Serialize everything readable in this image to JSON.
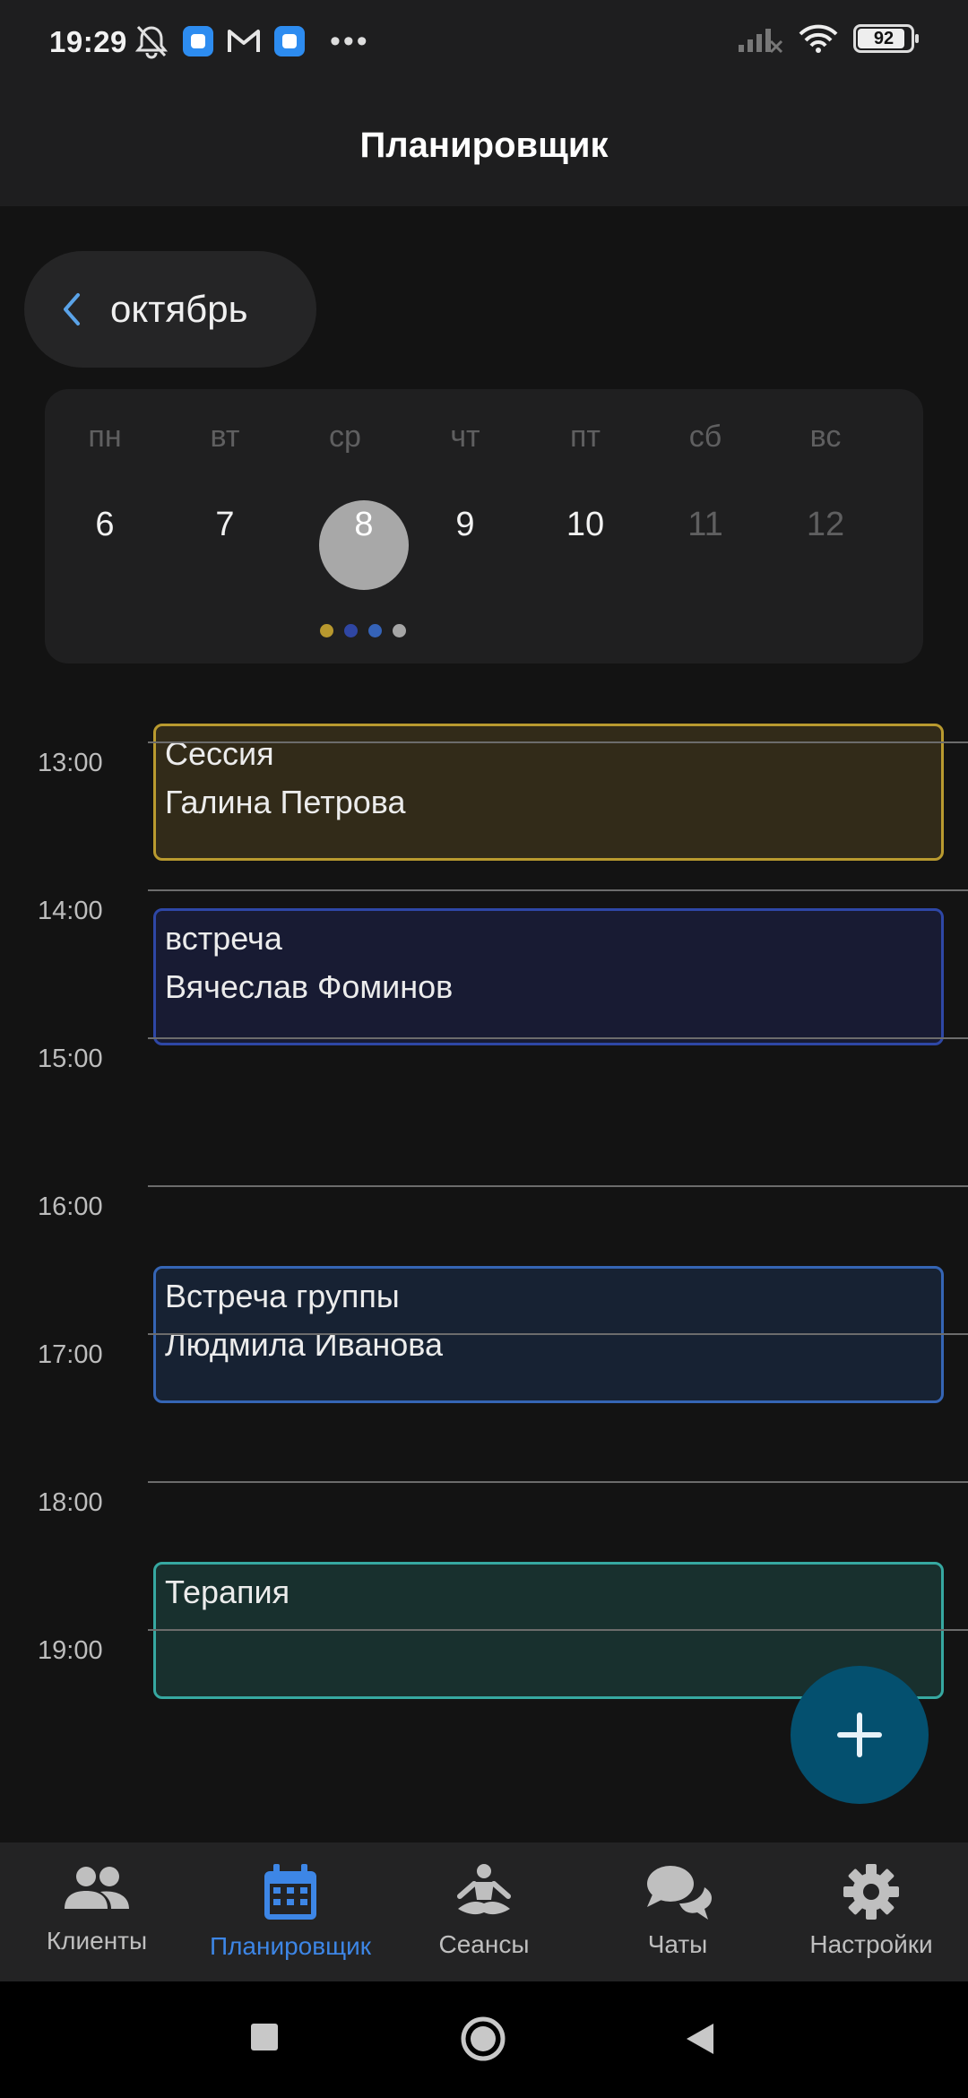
{
  "status_bar": {
    "time": "19:29",
    "battery": "92",
    "icons": [
      "mute-icon",
      "app-icon",
      "gmail-icon",
      "app-icon",
      "more-icon",
      "signal-icon",
      "wifi-icon",
      "battery-icon"
    ]
  },
  "header": {
    "title": "Планировщик"
  },
  "calendar": {
    "month": "октябрь",
    "weekdays": [
      "пн",
      "вт",
      "ср",
      "чт",
      "пт",
      "сб",
      "вс"
    ],
    "days": [
      "6",
      "7",
      "8",
      "9",
      "10",
      "11",
      "12"
    ],
    "selected_day": "8",
    "event_dot_colors": [
      "#b8982e",
      "#2f46a3",
      "#3563b8",
      "#a6a6a6"
    ]
  },
  "timeline": {
    "hours": [
      "13:00",
      "14:00",
      "15:00",
      "16:00",
      "17:00",
      "18:00",
      "19:00"
    ],
    "events": [
      {
        "title": "Сессия",
        "person": "Галина Петрова",
        "border": "#b99a2f",
        "fill": "#322b19"
      },
      {
        "title": "встреча",
        "person": "Вячеслав Фоминов",
        "border": "#2e47a6",
        "fill": "#181b33"
      },
      {
        "title": "Встреча группы",
        "person": "Людмила Иванова",
        "border": "#3565b5",
        "fill": "#172233"
      },
      {
        "title": "Терапия",
        "person": "",
        "border": "#36a8a1",
        "fill": "#18302e"
      }
    ]
  },
  "fab": {
    "icon": "plus-icon",
    "color": "#04506f"
  },
  "bottom_nav": {
    "items": [
      {
        "label": "Клиенты",
        "icon": "people-icon"
      },
      {
        "label": "Планировщик",
        "icon": "calendar-icon",
        "active": true
      },
      {
        "label": "Сеансы",
        "icon": "meditation-icon"
      },
      {
        "label": "Чаты",
        "icon": "chat-icon"
      },
      {
        "label": "Настройки",
        "icon": "gear-icon"
      }
    ],
    "active_color": "#3d86e6"
  },
  "system_nav": {
    "icons": [
      "recents-square-icon",
      "home-circle-icon",
      "back-triangle-icon"
    ]
  }
}
